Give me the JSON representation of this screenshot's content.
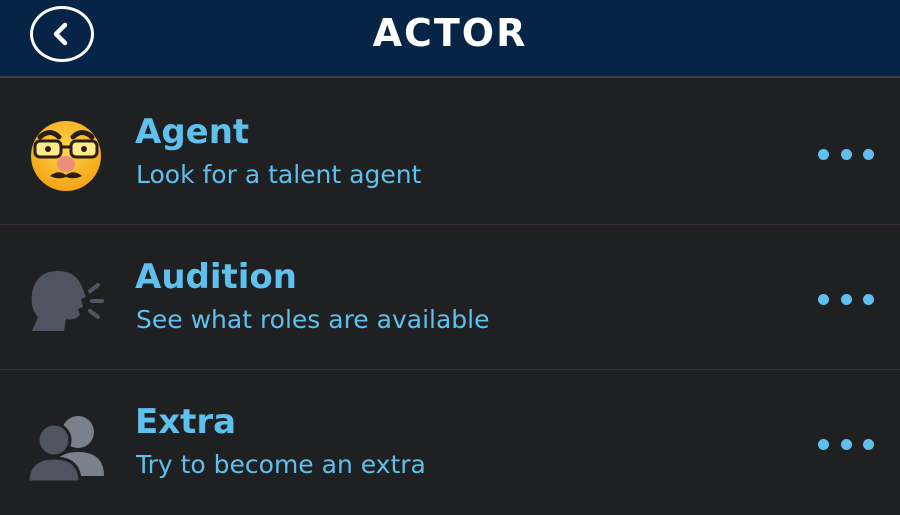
{
  "header": {
    "title": "ACTOR",
    "back_icon": "chevron-left-icon"
  },
  "rows": [
    {
      "title": "Agent",
      "subtitle": "Look for a talent agent",
      "icon": "disguise-face-icon"
    },
    {
      "title": "Audition",
      "subtitle": "See what roles are available",
      "icon": "speaking-head-icon"
    },
    {
      "title": "Extra",
      "subtitle": "Try to become an extra",
      "icon": "two-people-icon"
    }
  ],
  "colors": {
    "header_bg": "#062445",
    "page_bg": "#1f2022",
    "accent": "#5fc0ee",
    "divider": "#3b2f40"
  }
}
